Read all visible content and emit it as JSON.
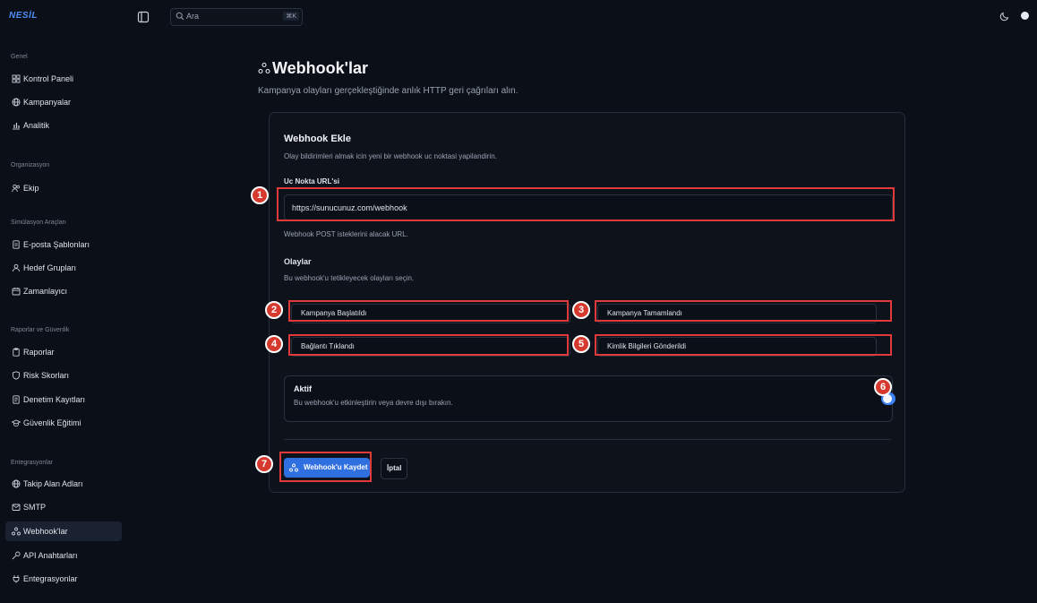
{
  "app": {
    "brand": "NESİL"
  },
  "search": {
    "placeholder": "Ara",
    "shortcut": "⌘K"
  },
  "sidebar": {
    "sections": [
      {
        "title": "Genel",
        "items": [
          {
            "label": "Kontrol Paneli",
            "icon": "grid-icon"
          },
          {
            "label": "Kampanyalar",
            "icon": "globe-icon"
          },
          {
            "label": "Analitik",
            "icon": "chart-icon"
          }
        ]
      },
      {
        "title": "Organizasyon",
        "items": [
          {
            "label": "Ekip",
            "icon": "users-icon"
          }
        ]
      },
      {
        "title": "Simülasyon Araçları",
        "items": [
          {
            "label": "E-posta Şablonları",
            "icon": "file-icon"
          },
          {
            "label": "Hedef Grupları",
            "icon": "group-icon"
          },
          {
            "label": "Zamanlayıcı",
            "icon": "calendar-icon"
          }
        ]
      },
      {
        "title": "Raporlar ve Güvenlik",
        "items": [
          {
            "label": "Raporlar",
            "icon": "report-icon"
          },
          {
            "label": "Risk Skorları",
            "icon": "shield-icon"
          },
          {
            "label": "Denetim Kayıtları",
            "icon": "log-icon"
          },
          {
            "label": "Güvenlik Eğitimi",
            "icon": "graduation-icon"
          }
        ]
      },
      {
        "title": "Entegrasyonlar",
        "items": [
          {
            "label": "Takip Alan Adları",
            "icon": "globe-icon"
          },
          {
            "label": "SMTP",
            "icon": "mail-icon"
          },
          {
            "label": "Webhook'lar",
            "icon": "webhook-icon",
            "active": true
          },
          {
            "label": "API Anahtarları",
            "icon": "key-icon"
          },
          {
            "label": "Entegrasyonlar",
            "icon": "plug-icon"
          }
        ]
      }
    ]
  },
  "page": {
    "title": "Webhook'lar",
    "subtitle": "Kampanya olayları gerçekleştiğinde anlık HTTP geri çağrıları alın."
  },
  "form": {
    "title": "Webhook Ekle",
    "description": "Olay bildirimleri almak icin yeni bir webhook uc noktasi yapilandirin.",
    "url_label": "Uc Nokta URL'si",
    "url_value": "https://sunucunuz.com/webhook",
    "url_hint": "Webhook POST isteklerini alacak URL.",
    "events_label": "Olaylar",
    "events_desc": "Bu webhook'u tetikleyecek olayları seçin.",
    "events": [
      "Kampanya Başlatıldı",
      "Kampanya Tamamlandı",
      "Bağlantı Tıklandı",
      "Kimlik Bilgileri Gönderildi"
    ],
    "active_title": "Aktif",
    "active_desc": "Bu webhook'u etkinleştirin veya devre dışı bırakın.",
    "active_on": true,
    "save_label": "Webhook'u Kaydet",
    "cancel_label": "İptal"
  },
  "annotations": [
    "1",
    "2",
    "3",
    "4",
    "5",
    "6",
    "7"
  ],
  "colors": {
    "accent": "#2f6fe0",
    "annotation": "#e23a3a",
    "background": "#0b0f17"
  }
}
